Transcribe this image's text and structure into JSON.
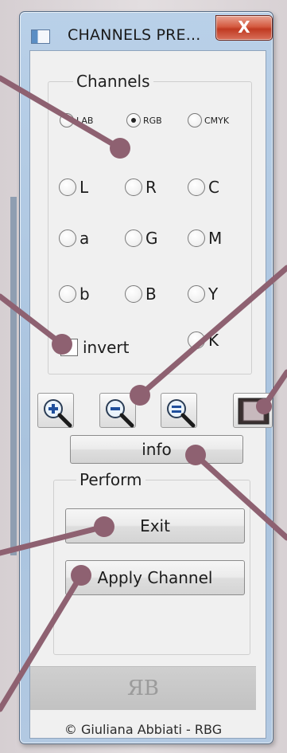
{
  "window": {
    "title": "CHANNELS PRE...",
    "close_label": "X"
  },
  "channels_group": {
    "legend": "Channels",
    "modes": [
      {
        "label": "LAB",
        "checked": false
      },
      {
        "label": "RGB",
        "checked": true
      },
      {
        "label": "CMYK",
        "checked": false
      }
    ],
    "channel_rows": [
      [
        "L",
        "R",
        "C"
      ],
      [
        "a",
        "G",
        "M"
      ],
      [
        "b",
        "B",
        "Y"
      ]
    ],
    "invert_label": "invert",
    "k_label": "K"
  },
  "toolbar": {
    "zoom_in_icon": "zoom-in-icon",
    "zoom_out_icon": "zoom-out-icon",
    "zoom_fit_icon": "zoom-fit-icon",
    "preview_icon": "preview-icon"
  },
  "info_button": "info",
  "perform_group": {
    "legend": "Perform",
    "exit_label": "Exit",
    "apply_label": "Apply Channel"
  },
  "logo": "ЯB",
  "copyright": "© Giuliana Abbiati - RBG",
  "colors": {
    "callout": "#8e6171",
    "window_frame": "#a9c3de",
    "close_button": "#c9452c"
  }
}
